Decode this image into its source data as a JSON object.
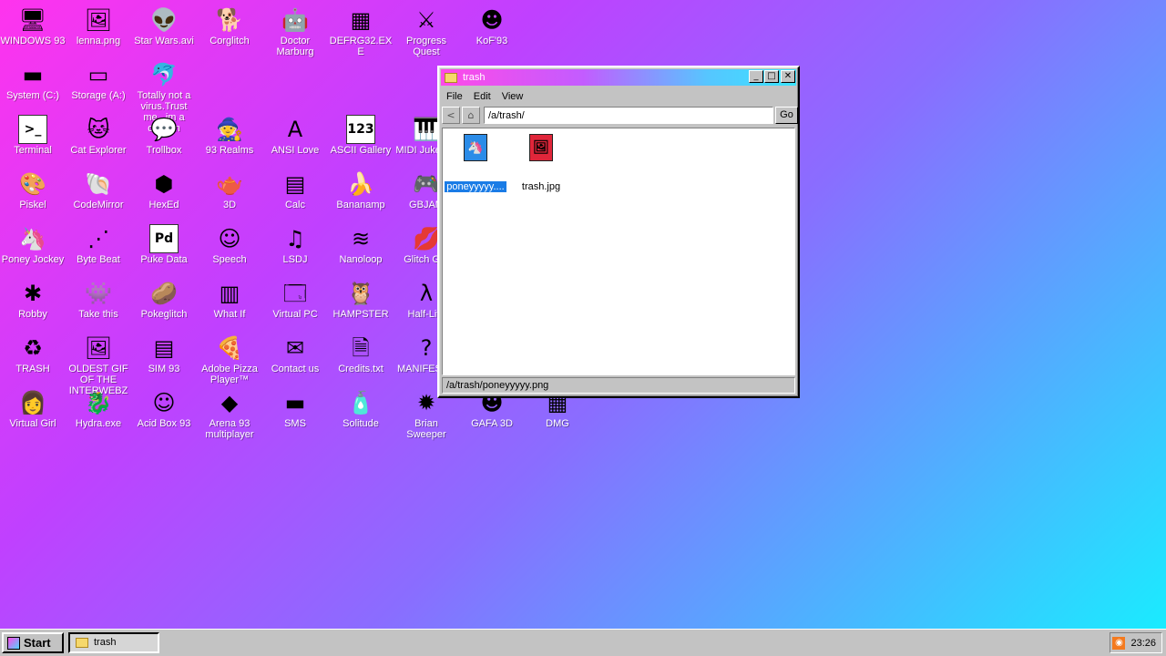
{
  "desktop": {
    "icons": [
      {
        "label": "WINDOWS 93",
        "glyph": "🖥",
        "icon": "computer-icon"
      },
      {
        "label": "lenna.png",
        "glyph": "🖼",
        "icon": "image-file-icon"
      },
      {
        "label": "Star Wars.avi",
        "glyph": "👽",
        "icon": "yoda-icon"
      },
      {
        "label": "Corglitch",
        "glyph": "🐕",
        "icon": "corgi-icon"
      },
      {
        "label": "Doctor Marburg",
        "glyph": "🤖",
        "icon": "doctor-icon"
      },
      {
        "label": "DEFRG32.EXE",
        "glyph": "▦",
        "icon": "defrag-icon"
      },
      {
        "label": "Progress Quest",
        "glyph": "⚔",
        "icon": "swords-icon"
      },
      {
        "label": "KoF'93",
        "glyph": "☻",
        "icon": "fighter-icon"
      },
      {
        "label": "System (C:)",
        "glyph": "▬",
        "icon": "drive-c-icon"
      },
      {
        "label": "Storage (A:)",
        "glyph": "▭",
        "icon": "drive-a-icon"
      },
      {
        "label": "Totally not a virus.Trust me...im a dolphin",
        "glyph": "🐬",
        "icon": "dolphin-icon"
      },
      {
        "label": "Terminal",
        "glyph": ">_",
        "icon": "terminal-icon"
      },
      {
        "label": "Cat Explorer",
        "glyph": "🐱",
        "icon": "cat-globe-icon"
      },
      {
        "label": "Trollbox",
        "glyph": "💬",
        "icon": "chat-icon"
      },
      {
        "label": "93 Realms",
        "glyph": "🧙",
        "icon": "realms-icon"
      },
      {
        "label": "ANSI Love",
        "glyph": "A",
        "icon": "ansi-icon"
      },
      {
        "label": "ASCII Gallery",
        "glyph": "123",
        "icon": "ascii-icon"
      },
      {
        "label": "MIDI Jukebox",
        "glyph": "🎹",
        "icon": "piano-icon"
      },
      {
        "label": "Piskel",
        "glyph": "🎨",
        "icon": "palette-icon"
      },
      {
        "label": "CodeMirror",
        "glyph": "🐚",
        "icon": "codemirror-icon"
      },
      {
        "label": "HexEd",
        "glyph": "⬢",
        "icon": "hexagon-icon"
      },
      {
        "label": "3D",
        "glyph": "🫖",
        "icon": "teapot-icon"
      },
      {
        "label": "Calc",
        "glyph": "▤",
        "icon": "calculator-icon"
      },
      {
        "label": "Bananamp",
        "glyph": "🍌",
        "icon": "banana-icon"
      },
      {
        "label": "GBJAM",
        "glyph": "🎮",
        "icon": "speaker-icon"
      },
      {
        "label": "Poney Jockey",
        "glyph": "🦄",
        "icon": "pony-icon"
      },
      {
        "label": "Byte Beat",
        "glyph": "⋰",
        "icon": "wave-icon"
      },
      {
        "label": "Puke Data",
        "glyph": "Pd",
        "icon": "puredata-icon"
      },
      {
        "label": "Speech",
        "glyph": "☺",
        "icon": "face-icon"
      },
      {
        "label": "LSDJ",
        "glyph": "♫",
        "icon": "lsdj-icon"
      },
      {
        "label": "Nanoloop",
        "glyph": "≋",
        "icon": "nanoloop-icon"
      },
      {
        "label": "Glitch GIF",
        "glyph": "💋",
        "icon": "lips-icon"
      },
      {
        "label": "Robby",
        "glyph": "✱",
        "icon": "stick-figure-icon"
      },
      {
        "label": "Take this",
        "glyph": "👾",
        "icon": "character-icon"
      },
      {
        "label": "Pokeglitch",
        "glyph": "🥔",
        "icon": "potato-icon"
      },
      {
        "label": "What If",
        "glyph": "▥",
        "icon": "matrix-icon"
      },
      {
        "label": "Virtual PC",
        "glyph": "🗔",
        "icon": "window-icon"
      },
      {
        "label": "HAMPSTER",
        "glyph": "🦉",
        "icon": "owl-icon"
      },
      {
        "label": "Half-Life",
        "glyph": "λ",
        "icon": "lambda-icon"
      },
      {
        "label": "TRASH",
        "glyph": "♻",
        "icon": "recycle-bin-icon"
      },
      {
        "label": "OLDEST GIF OF THE INTERWEBZ",
        "glyph": "🖼",
        "icon": "gif-icon"
      },
      {
        "label": "SIM 93",
        "glyph": "▤",
        "icon": "sim-icon"
      },
      {
        "label": "Adobe Pizza Player™",
        "glyph": "🍕",
        "icon": "pizza-icon"
      },
      {
        "label": "Contact us",
        "glyph": "✉",
        "icon": "contact-icon"
      },
      {
        "label": "Credits.txt",
        "glyph": "🗎",
        "icon": "text-file-icon"
      },
      {
        "label": "MANIFESTO",
        "glyph": "?",
        "icon": "question-icon"
      },
      {
        "label": "Virtual Girl",
        "glyph": "👩",
        "icon": "girl-icon"
      },
      {
        "label": "Hydra.exe",
        "glyph": "🐉",
        "icon": "hydra-icon"
      },
      {
        "label": "Acid Box 93",
        "glyph": "☺",
        "icon": "smiley-icon"
      },
      {
        "label": "Arena 93 multiplayer",
        "glyph": "◆",
        "icon": "cube-icon"
      },
      {
        "label": "SMS",
        "glyph": "▬",
        "icon": "console-icon"
      },
      {
        "label": "Solitude",
        "glyph": "🧴",
        "icon": "bottle-icon"
      },
      {
        "label": "Brian Sweeper",
        "glyph": "✹",
        "icon": "mine-icon"
      },
      {
        "label": "GAFA 3D",
        "glyph": "☻",
        "icon": "head-icon"
      },
      {
        "label": "DMG",
        "glyph": "▦",
        "icon": "dmg-icon"
      }
    ]
  },
  "window": {
    "title": "trash",
    "buttons": {
      "minimize": "_",
      "maximize": "□",
      "close": "✕"
    },
    "menu": [
      "File",
      "Edit",
      "View"
    ],
    "nav": {
      "back": "<",
      "home": "⌂"
    },
    "address": "/a/trash/",
    "go_label": "Go",
    "files": [
      {
        "name": "poneyyyyy.png",
        "display": "poneyyyyy....",
        "selected": true,
        "glyph": "🦄",
        "color": "#2b8ce8"
      },
      {
        "name": "trash.jpg",
        "display": "trash.jpg",
        "selected": false,
        "glyph": "🖼",
        "color": "#e0263a"
      }
    ],
    "status": "/a/trash/poneyyyyy.png"
  },
  "taskbar": {
    "start_label": "Start",
    "task": "trash",
    "clock": "23:26"
  }
}
